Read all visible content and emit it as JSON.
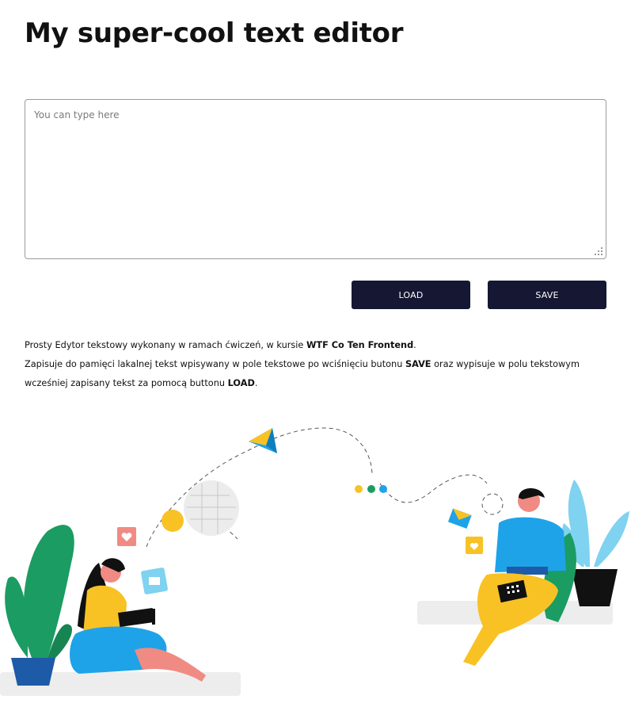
{
  "header": {
    "title": "My super-cool text editor"
  },
  "editor": {
    "placeholder": "You can type here",
    "value": ""
  },
  "actions": {
    "load_label": "LOAD",
    "save_label": "SAVE"
  },
  "description": {
    "line1_prefix": "Prosty Edytor tekstowy wykonany w ramach ćwiczeń, w kursie ",
    "line1_course": "WTF Co Ten Frontend",
    "line1_suffix": ".",
    "line2_prefix": "Zapisuje do pamięci lakalnej tekst wpisywany w pole tekstowe po wciśnięciu butonu ",
    "line2_save": "SAVE",
    "line2_suffix": " oraz wypisuje w polu tekstowym",
    "line3_prefix": "wcześniej zapisany tekst za pomocą buttonu ",
    "line3_load": "LOAD",
    "line3_suffix": "."
  },
  "colors": {
    "button_bg": "#161733",
    "accent_yellow": "#f8c225",
    "accent_blue": "#1ea3e8",
    "accent_green": "#1b9c62",
    "accent_pink": "#f08b84"
  },
  "illustration": {
    "name": "people-working-on-laptops-illustration"
  }
}
